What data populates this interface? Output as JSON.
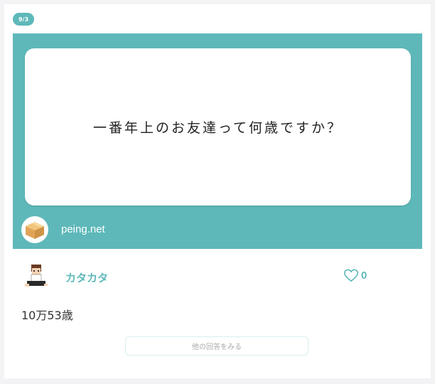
{
  "date_badge": "9/3",
  "question": {
    "text": "一番年上のお友達って何歳ですか？",
    "site": "peing.net",
    "site_icon": "cardboard-box-icon"
  },
  "answerer": {
    "name": "カタカタ",
    "avatar_icon": "pixel-character-avatar"
  },
  "like": {
    "icon": "heart-outline-icon",
    "count": "0"
  },
  "answer": {
    "text": "10万53歳"
  },
  "more_button": {
    "label": "他の回答をみる"
  },
  "colors": {
    "accent": "#5eb8b9",
    "background": "#f3f3f5"
  }
}
